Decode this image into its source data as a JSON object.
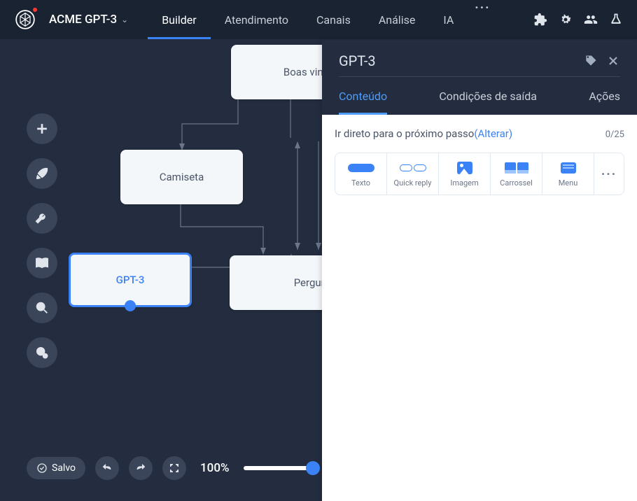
{
  "app": {
    "title": "ACME GPT-3"
  },
  "nav": {
    "tabs": [
      "Builder",
      "Atendimento",
      "Canais",
      "Análise",
      "IA"
    ],
    "active": 0
  },
  "nodes": {
    "boas_vindas": "Boas vindas",
    "camiseta": "Camiseta",
    "gpt3": "GPT-3",
    "pergunta": "Pergunta"
  },
  "bottom": {
    "save": "Salvo",
    "zoom": "100%"
  },
  "panel": {
    "title": "GPT-3",
    "tabs": {
      "content": "Conteúdo",
      "exit": "Condições de saída",
      "actions": "Ações"
    },
    "skip_text": "Ir direto para o próximo passo ",
    "alter": "(Alterar)",
    "count": "0/25",
    "types": {
      "texto": "Texto",
      "quick": "Quick reply",
      "imagem": "Imagem",
      "carrossel": "Carrossel",
      "menu": "Menu"
    }
  }
}
